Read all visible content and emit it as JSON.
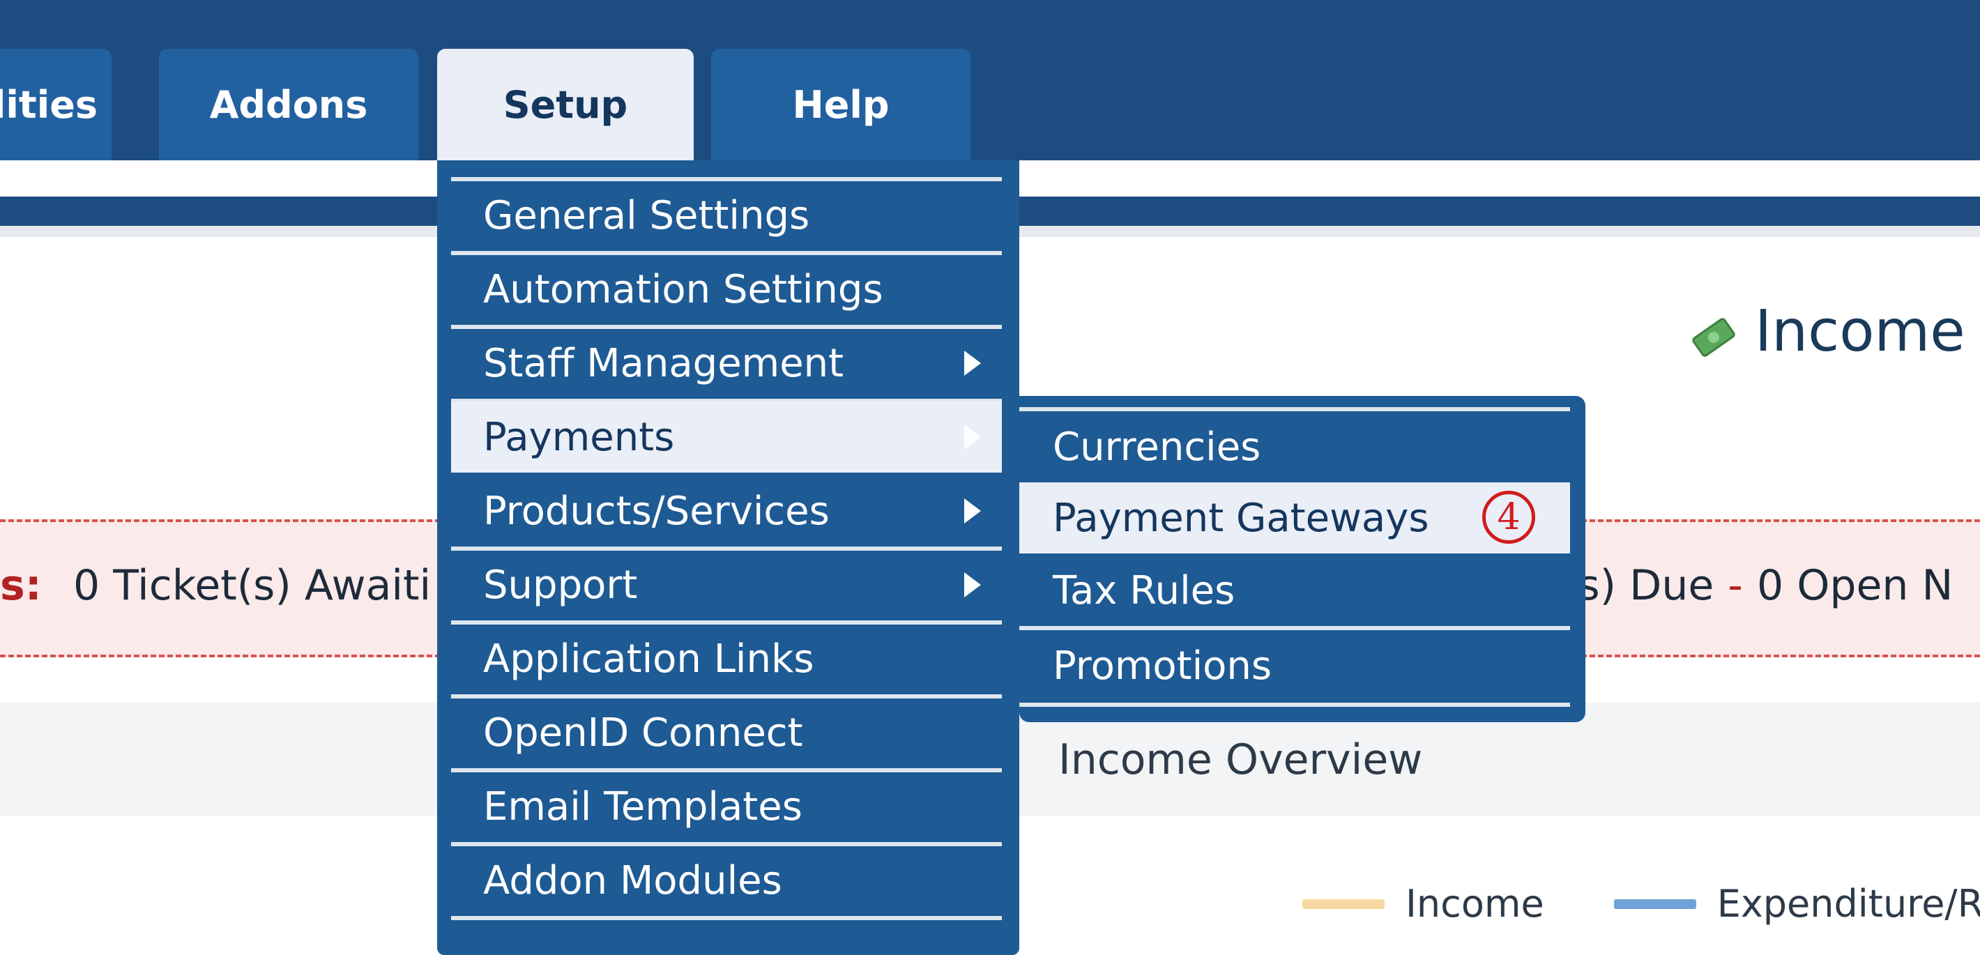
{
  "nav": {
    "tabs": [
      {
        "label": "lities"
      },
      {
        "label": "Addons"
      },
      {
        "label": "Setup"
      },
      {
        "label": "Help"
      }
    ]
  },
  "setup_menu": {
    "items": [
      {
        "label": "General Settings"
      },
      {
        "label": "Automation Settings"
      },
      {
        "label": "Staff Management"
      },
      {
        "label": "Payments"
      },
      {
        "label": "Products/Services"
      },
      {
        "label": "Support"
      },
      {
        "label": "Application Links"
      },
      {
        "label": "OpenID Connect"
      },
      {
        "label": "Email Templates"
      },
      {
        "label": "Addon Modules"
      }
    ]
  },
  "payments_submenu": {
    "items": [
      {
        "label": "Currencies"
      },
      {
        "label": "Payment Gateways"
      },
      {
        "label": "Tax Rules"
      },
      {
        "label": "Promotions"
      }
    ],
    "step_badge": "4"
  },
  "dashboard": {
    "income_title": "Income",
    "alert_label": "s:",
    "alert_left": "0 Ticket(s) Awaiti",
    "alert_right_a": "(s) Due",
    "alert_sep": "-",
    "alert_right_b": "0 Open N",
    "overview_title": "Income Overview",
    "legend": [
      {
        "label": "Income",
        "color": "#f6d9a0"
      },
      {
        "label": "Expenditure/R",
        "color": "#6fa2d6"
      }
    ]
  },
  "colors": {
    "nav_bg": "#1d4d80",
    "tab_bg": "#2261a0",
    "menu_bg": "#1e5a94",
    "selected_bg": "#e9eef7",
    "alert_red": "#d9534f"
  }
}
